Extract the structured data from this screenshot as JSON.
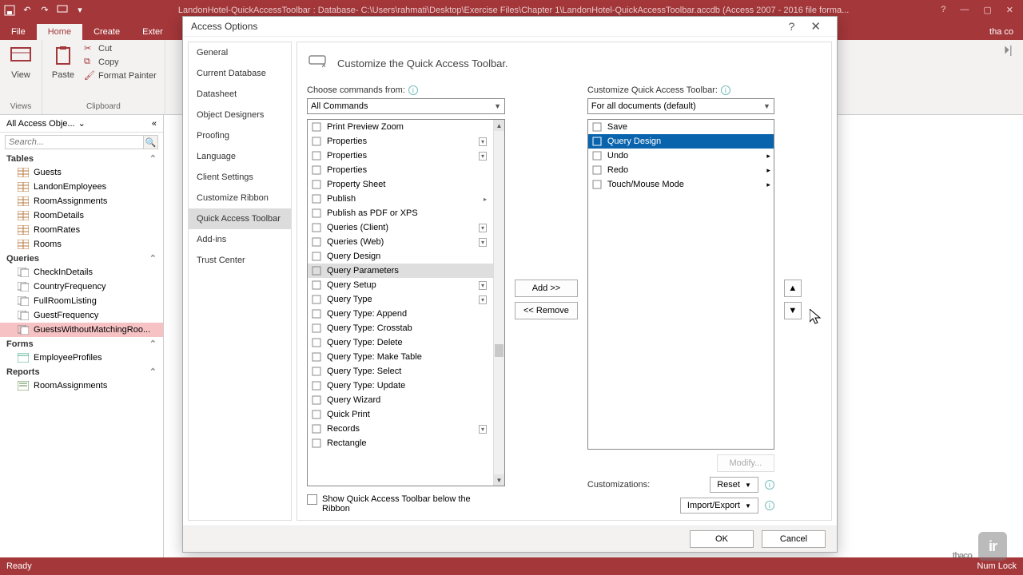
{
  "titlebar": {
    "title": "LandonHotel-QuickAccessToolbar : Database- C:\\Users\\rahmati\\Desktop\\Exercise Files\\Chapter 1\\LandonHotel-QuickAccessToolbar.accdb (Access 2007 - 2016 file forma..."
  },
  "ribbon": {
    "tabs": [
      "File",
      "Home",
      "Create",
      "Exter"
    ],
    "right": "tha co",
    "groups": {
      "views": "Views",
      "view": "View",
      "clipboard": "Clipboard",
      "paste": "Paste",
      "cut": "Cut",
      "copy": "Copy",
      "fmtpainter": "Format Painter"
    }
  },
  "nav": {
    "header": "All Access Obje...",
    "search_ph": "Search...",
    "sections": {
      "tables": "Tables",
      "queries": "Queries",
      "forms": "Forms",
      "reports": "Reports"
    },
    "tables": [
      "Guests",
      "LandonEmployees",
      "RoomAssignments",
      "RoomDetails",
      "RoomRates",
      "Rooms"
    ],
    "queries": [
      "CheckInDetails",
      "CountryFrequency",
      "FullRoomListing",
      "GuestFrequency",
      "GuestsWithoutMatchingRoo..."
    ],
    "forms": [
      "EmployeeProfiles"
    ],
    "reports": [
      "RoomAssignments"
    ]
  },
  "dialog": {
    "title": "Access Options",
    "categories": [
      "General",
      "Current Database",
      "Datasheet",
      "Object Designers",
      "Proofing",
      "Language",
      "Client Settings",
      "Customize Ribbon",
      "Quick Access Toolbar",
      "Add-ins",
      "Trust Center"
    ],
    "header": "Customize the Quick Access Toolbar.",
    "choose_lbl": "Choose commands from:",
    "choose_val": "All Commands",
    "custom_lbl": "Customize Quick Access Toolbar:",
    "custom_val": "For all documents (default)",
    "commands": [
      {
        "t": "Print Preview Zoom",
        "i": "zoom"
      },
      {
        "t": "Properties",
        "i": "prop",
        "d": true
      },
      {
        "t": "Properties",
        "i": "prop",
        "d": true
      },
      {
        "t": "Properties",
        "i": "grid"
      },
      {
        "t": "Property Sheet",
        "i": "sheet"
      },
      {
        "t": "Publish",
        "i": "pub",
        "s": true
      },
      {
        "t": "Publish as PDF or XPS",
        "i": "pdf"
      },
      {
        "t": "Queries (Client)",
        "i": "",
        "d": true
      },
      {
        "t": "Queries (Web)",
        "i": "",
        "d": true
      },
      {
        "t": "Query Design",
        "i": "qd"
      },
      {
        "t": "Query Parameters",
        "i": "qp",
        "sel": true
      },
      {
        "t": "Query Setup",
        "i": "",
        "d": true
      },
      {
        "t": "Query Type",
        "i": "",
        "d": true
      },
      {
        "t": "Query Type: Append",
        "i": "append"
      },
      {
        "t": "Query Type: Crosstab",
        "i": "cross"
      },
      {
        "t": "Query Type: Delete",
        "i": "del"
      },
      {
        "t": "Query Type: Make Table",
        "i": "make"
      },
      {
        "t": "Query Type: Select",
        "i": "sel"
      },
      {
        "t": "Query Type: Update",
        "i": "upd"
      },
      {
        "t": "Query Wizard",
        "i": "wiz"
      },
      {
        "t": "Quick Print",
        "i": "print"
      },
      {
        "t": "Records",
        "i": "",
        "d": true
      },
      {
        "t": "Rectangle",
        "i": "rect"
      }
    ],
    "qat_items": [
      {
        "t": "Save",
        "i": "save"
      },
      {
        "t": "Query Design",
        "i": "qd",
        "sel": true
      },
      {
        "t": "Undo",
        "i": "undo",
        "s": true
      },
      {
        "t": "Redo",
        "i": "redo",
        "s": true
      },
      {
        "t": "Touch/Mouse Mode",
        "i": "touch",
        "s": true
      }
    ],
    "add": "Add >>",
    "remove": "<< Remove",
    "modify": "Modify...",
    "customizations": "Customizations:",
    "reset": "Reset",
    "importexport": "Import/Export",
    "show_below": "Show Quick Access Toolbar below the Ribbon",
    "ok": "OK",
    "cancel": "Cancel"
  },
  "status": {
    "ready": "Ready",
    "numlock": "Num Lock"
  },
  "watermark": "thaco",
  "watermark_sq": "ir"
}
